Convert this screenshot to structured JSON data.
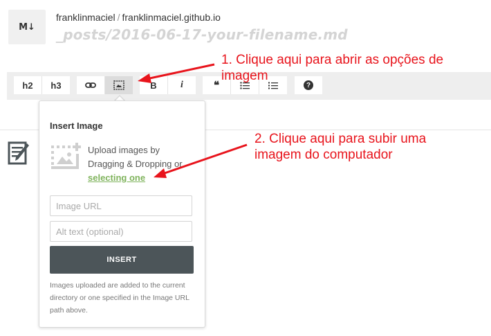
{
  "header": {
    "logo": "M↓",
    "owner": "franklinmaciel",
    "separator": "/",
    "repo": "franklinmaciel.github.io",
    "file_path": "_posts/2016-06-17-your-filename.md"
  },
  "toolbar": {
    "h2": "h2",
    "h3": "h3",
    "bold": "B",
    "italic": "i",
    "quote": "❝",
    "help": "?"
  },
  "insert_image": {
    "title": "Insert Image",
    "upload_text": "Upload images by Dragging & Dropping or",
    "upload_link": "selecting one",
    "url_placeholder": "Image URL",
    "alt_placeholder": "Alt text (optional)",
    "insert_label": "INSERT",
    "help_text": "Images uploaded are added to the current directory or one specified in the Image URL path above."
  },
  "annotations": {
    "step1_line1": "1. Clique aqui para abrir as opções de",
    "step1_line2": "imagem",
    "step2_line1": "2. Clique aqui para subir uma",
    "step2_line2": "imagem do computador",
    "color": "#e8141c"
  }
}
